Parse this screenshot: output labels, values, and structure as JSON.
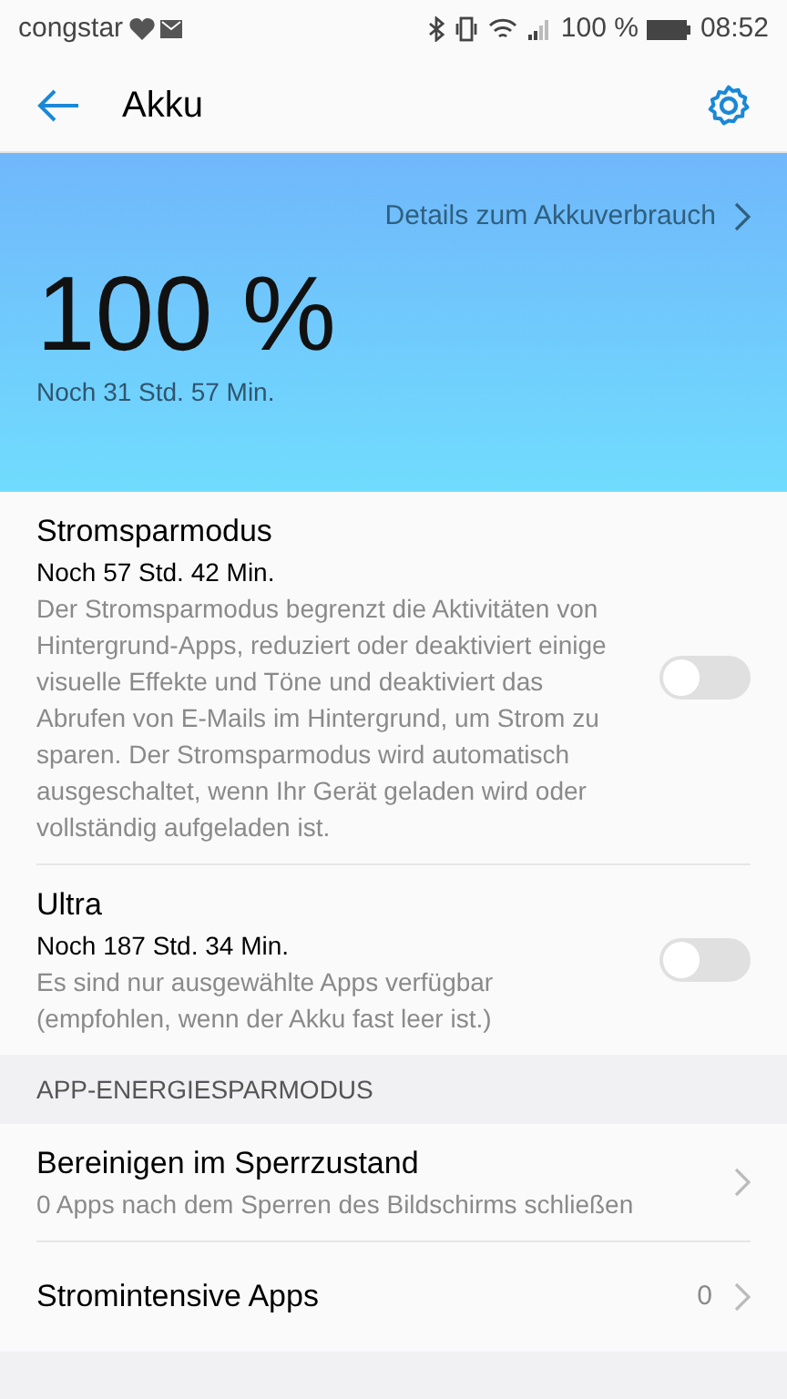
{
  "status_bar": {
    "carrier": "congstar",
    "battery": "100 %",
    "time": "08:52"
  },
  "header": {
    "title": "Akku"
  },
  "battery": {
    "details_link": "Details zum Akkuverbrauch",
    "percent": "100 %",
    "remaining": "Noch 31 Std. 57 Min."
  },
  "modes": [
    {
      "title": "Stromsparmodus",
      "remaining": "Noch 57 Std. 42 Min.",
      "description": "Der Stromsparmodus begrenzt die Aktivitäten von Hintergrund-Apps, reduziert oder deaktiviert einige visuelle Effekte und Töne und deaktiviert das Abrufen von E-Mails im Hintergrund, um Strom zu sparen. Der Stromsparmodus wird automatisch ausgeschaltet, wenn Ihr Gerät geladen wird oder vollständig aufgeladen ist.",
      "on": false
    },
    {
      "title": "Ultra",
      "remaining": "Noch 187 Std. 34 Min.",
      "description": "Es sind nur ausgewählte Apps verfügbar (empfohlen, wenn der Akku fast leer ist.)",
      "on": false
    }
  ],
  "section": {
    "title": "APP-ENERGIESPARMODUS"
  },
  "items": [
    {
      "title": "Bereinigen im Sperrzustand",
      "subtitle": "0 Apps nach dem Sperren des Bildschirms schließen"
    },
    {
      "title": "Stromintensive Apps",
      "value": "0"
    }
  ]
}
